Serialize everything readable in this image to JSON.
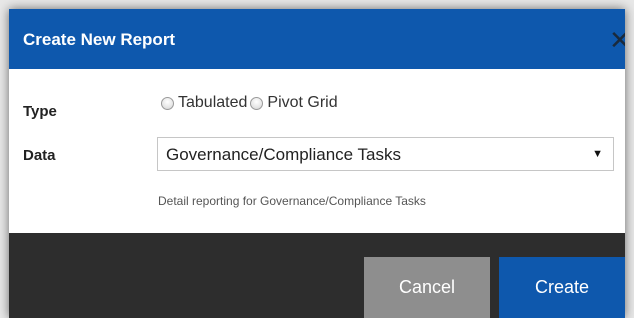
{
  "dialog": {
    "title": "Create New Report",
    "close_glyph": "✕",
    "close_icon": "close-icon"
  },
  "form": {
    "type_label": "Type",
    "type_options": [
      "Tabulated",
      "Pivot Grid"
    ],
    "data_label": "Data",
    "data_selected": "Governance/Compliance Tasks",
    "data_arrow": "▼",
    "data_help": "Detail reporting for Governance/Compliance Tasks"
  },
  "footer": {
    "cancel_label": "Cancel",
    "create_label": "Create"
  },
  "colors": {
    "accent": "#0e58ad",
    "footer": "#2d2d2d",
    "cancel": "#8e8e8e"
  }
}
